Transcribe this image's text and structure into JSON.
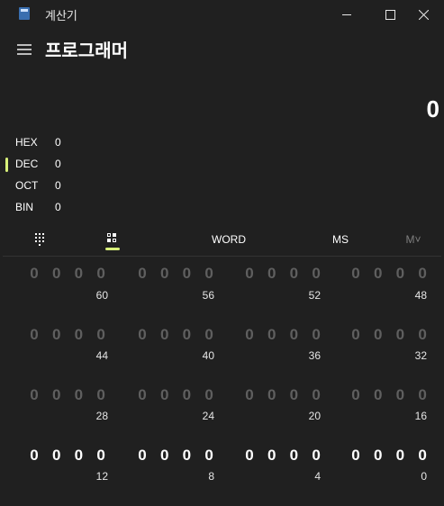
{
  "window": {
    "title": "계산기",
    "minimize_icon": "minimize-icon",
    "maximize_icon": "maximize-icon",
    "close_icon": "close-icon"
  },
  "header": {
    "menu_icon": "hamburger-icon",
    "mode_title": "프로그래머"
  },
  "display": {
    "value": "0"
  },
  "radix": [
    {
      "label": "HEX",
      "value": "0",
      "selected": false
    },
    {
      "label": "DEC",
      "value": "0",
      "selected": true
    },
    {
      "label": "OCT",
      "value": "0",
      "selected": false
    },
    {
      "label": "BIN",
      "value": "0",
      "selected": false
    }
  ],
  "toolbar": {
    "keypad_icon": "full-keypad-icon",
    "bitflip_icon": "bit-toggle-keypad-icon",
    "word_label": "WORD",
    "ms_label": "MS",
    "mv_label": "M˅"
  },
  "bits": {
    "rows": [
      {
        "digits": [
          "0",
          "0",
          "0",
          "0",
          "0",
          "0",
          "0",
          "0",
          "0",
          "0",
          "0",
          "0",
          "0",
          "0",
          "0",
          "0"
        ],
        "positions": [
          "60",
          "56",
          "52",
          "48"
        ],
        "active": false
      },
      {
        "digits": [
          "0",
          "0",
          "0",
          "0",
          "0",
          "0",
          "0",
          "0",
          "0",
          "0",
          "0",
          "0",
          "0",
          "0",
          "0",
          "0"
        ],
        "positions": [
          "44",
          "40",
          "36",
          "32"
        ],
        "active": false
      },
      {
        "digits": [
          "0",
          "0",
          "0",
          "0",
          "0",
          "0",
          "0",
          "0",
          "0",
          "0",
          "0",
          "0",
          "0",
          "0",
          "0",
          "0"
        ],
        "positions": [
          "28",
          "24",
          "20",
          "16"
        ],
        "active": false
      },
      {
        "digits": [
          "0",
          "0",
          "0",
          "0",
          "0",
          "0",
          "0",
          "0",
          "0",
          "0",
          "0",
          "0",
          "0",
          "0",
          "0",
          "0"
        ],
        "positions": [
          "12",
          "8",
          "4",
          "0"
        ],
        "active": true
      }
    ]
  },
  "colors": {
    "background": "#202020",
    "accent": "#d8f07a",
    "text": "#ffffff",
    "dim_bit": "#5f5f5f"
  }
}
